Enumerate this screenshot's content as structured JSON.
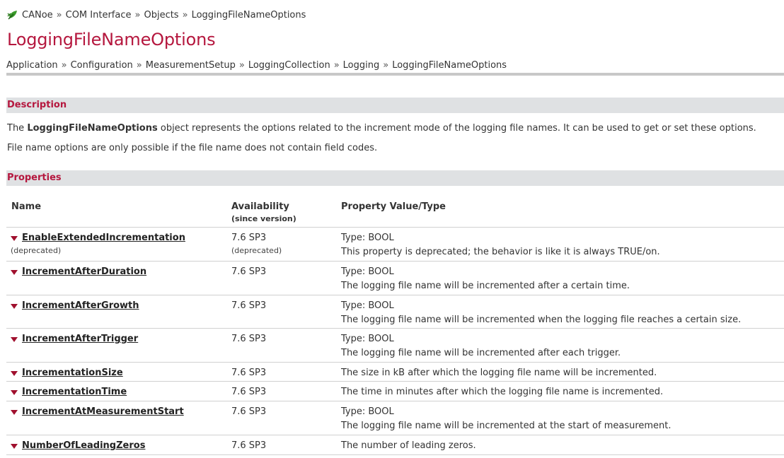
{
  "breadcrumb_top": {
    "items": [
      "CANoe",
      "COM Interface",
      "Objects",
      "LoggingFileNameOptions"
    ],
    "separator": "»"
  },
  "page_title": "LoggingFileNameOptions",
  "breadcrumb_main": {
    "items": [
      "Application",
      "Configuration",
      "MeasurementSetup",
      "LoggingCollection",
      "Logging",
      "LoggingFileNameOptions"
    ],
    "separator": "»"
  },
  "description": {
    "heading": "Description",
    "para1_pre": "The ",
    "para1_bold": "LoggingFileNameOptions",
    "para1_post": " object represents the options related to the increment mode of the logging file names. It can be used to get or set these options.",
    "para2": "File name options are only possible if the file name does not contain field codes."
  },
  "properties": {
    "heading": "Properties",
    "col_name": "Name",
    "col_avail": "Availability",
    "col_avail_sub": "(since version)",
    "col_value": "Property Value/Type",
    "rows": [
      {
        "name": "EnableExtendedIncrementation",
        "name_note": "(deprecated)",
        "avail": "7.6 SP3",
        "avail_note": "(deprecated)",
        "type": "Type: BOOL",
        "desc": "This property is deprecated; the behavior is like it is always TRUE/on."
      },
      {
        "name": "IncrementAfterDuration",
        "avail": "7.6 SP3",
        "type": "Type: BOOL",
        "desc": "The logging file name will be incremented after a certain time."
      },
      {
        "name": "IncrementAfterGrowth",
        "avail": "7.6 SP3",
        "type": "Type: BOOL",
        "desc": "The logging file name will be incremented when the logging file reaches a certain size."
      },
      {
        "name": "IncrementAfterTrigger",
        "avail": "7.6 SP3",
        "type": "Type: BOOL",
        "desc": "The logging file name will be incremented after each trigger."
      },
      {
        "name": "IncrementationSize",
        "avail": "7.6 SP3",
        "desc": "The size in kB after which the logging file name will be incremented."
      },
      {
        "name": "IncrementationTime",
        "avail": "7.6 SP3",
        "desc": "The time in minutes after which the logging file name is incremented."
      },
      {
        "name": "IncrementAtMeasurementStart",
        "avail": "7.6 SP3",
        "type": "Type: BOOL",
        "desc": "The logging file name will be incremented at the start of measurement."
      },
      {
        "name": "NumberOfLeadingZeros",
        "avail": "7.6 SP3",
        "desc": "The number of leading zeros."
      }
    ]
  },
  "colors": {
    "accent": "#b5173e",
    "section_bg": "#dfe1e3",
    "leaf": "#2e8b2e"
  }
}
